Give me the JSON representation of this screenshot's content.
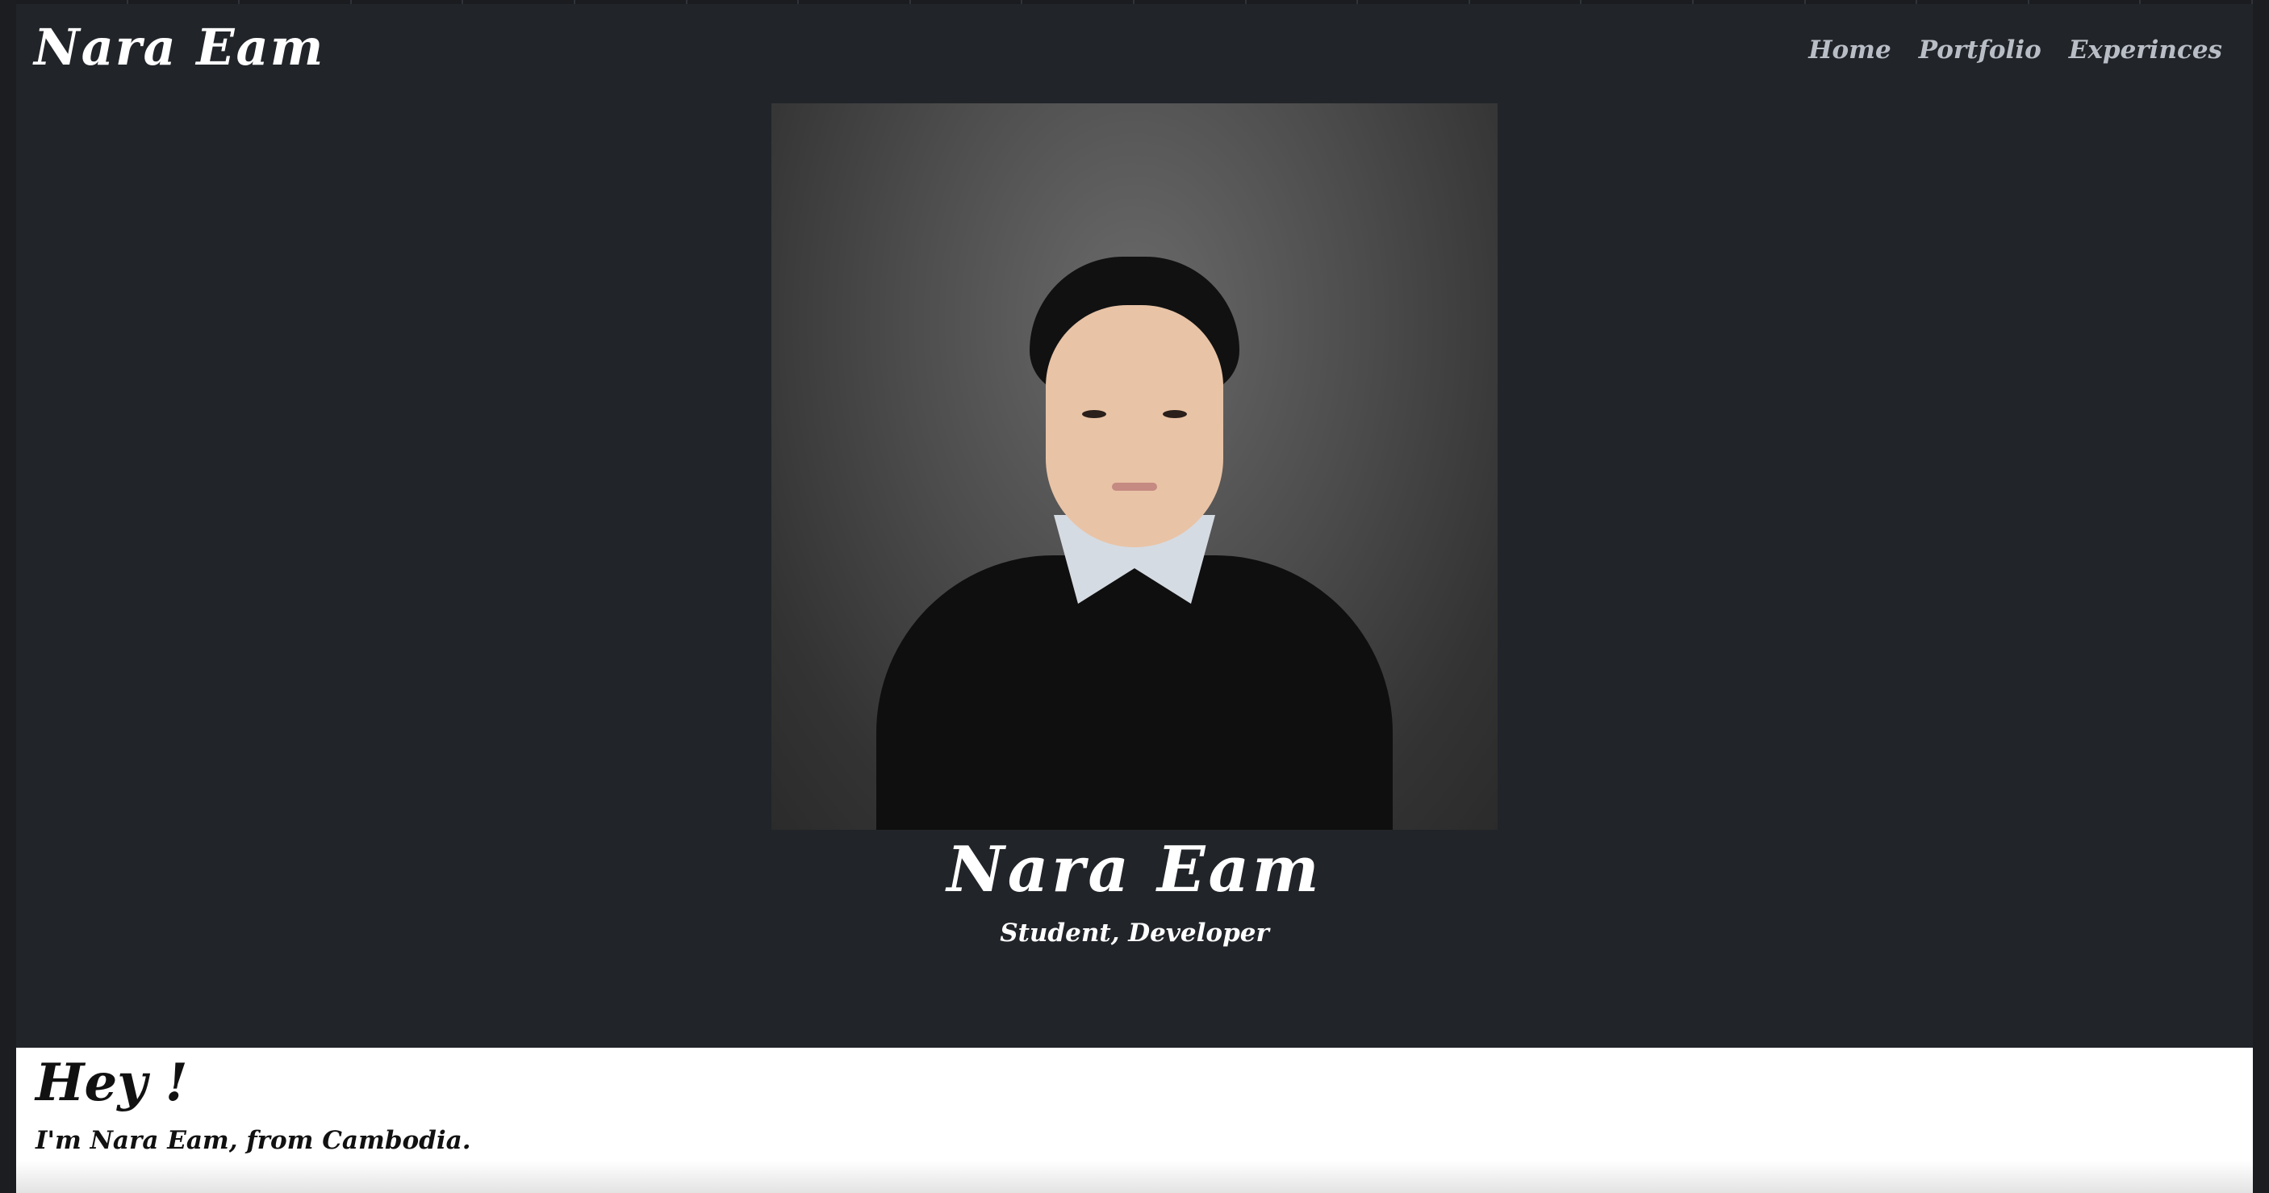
{
  "header": {
    "brand": "Nara Eam",
    "nav": [
      {
        "label": "Home"
      },
      {
        "label": "Portfolio"
      },
      {
        "label": "Experinces"
      }
    ]
  },
  "hero": {
    "photo_alt": "portrait of Nara Eam",
    "name": "Nara Eam",
    "role": "Student, Developer"
  },
  "about": {
    "heading": "Hey !",
    "text": "I'm Nara Eam, from Cambodia."
  },
  "colors": {
    "background": "#212429",
    "text": "#ffffff",
    "nav_text": "#b9bec6",
    "section_bg": "#ffffff"
  }
}
